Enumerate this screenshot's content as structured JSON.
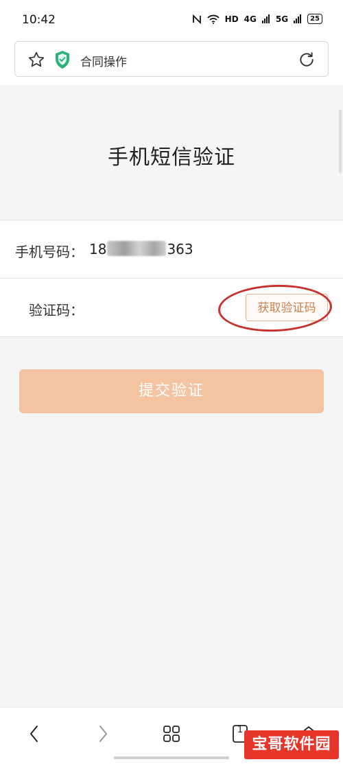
{
  "status_bar": {
    "time": "10:42",
    "network": "HD",
    "signal_1": "4G",
    "signal_2": "5G",
    "battery": "25"
  },
  "browser": {
    "page_title": "合同操作",
    "icons": [
      "star-icon",
      "shield-check-icon",
      "reload-icon"
    ],
    "shield_color": "#2db37a"
  },
  "page": {
    "title": "手机短信验证",
    "phone_label": "手机号码：",
    "phone_prefix": "18",
    "phone_suffix": "363",
    "code_label": "验证码：",
    "code_value": "",
    "get_code_label": "获取验证码",
    "submit_label": "提交验证",
    "accent_color": "#f4c4a2",
    "annotation_color": "#c8322e"
  },
  "bottom_nav": {
    "icons": [
      "back-icon",
      "forward-icon",
      "menu-grid-icon",
      "tabs-icon",
      "home-icon"
    ],
    "tab_count": "1"
  },
  "watermark": {
    "text": "宝哥软件园"
  }
}
